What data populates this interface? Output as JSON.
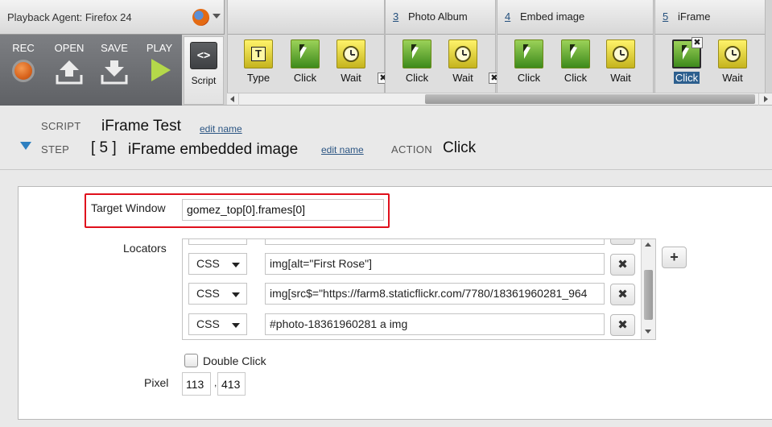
{
  "agent": {
    "title": "Playback Agent: Firefox 24",
    "browser_icon": "firefox-icon"
  },
  "controls": {
    "rec": "REC",
    "open": "OPEN",
    "save": "SAVE",
    "play": "PLAY",
    "script_icon": "<>",
    "script": "Script"
  },
  "groups": [
    {
      "number": "",
      "name": "",
      "actions": [
        {
          "label": "Type",
          "kind": "type"
        },
        {
          "label": "Click",
          "kind": "click"
        },
        {
          "label": "Wait",
          "kind": "wait"
        }
      ]
    },
    {
      "number": "3",
      "name": "Photo Album",
      "actions": [
        {
          "label": "Click",
          "kind": "click"
        },
        {
          "label": "Wait",
          "kind": "wait"
        }
      ]
    },
    {
      "number": "4",
      "name": "Embed image",
      "actions": [
        {
          "label": "Click",
          "kind": "click"
        },
        {
          "label": "Click",
          "kind": "click"
        },
        {
          "label": "Wait",
          "kind": "wait"
        }
      ]
    },
    {
      "number": "5",
      "name": "iFrame",
      "actions": [
        {
          "label": "Click",
          "kind": "click",
          "selected": true
        },
        {
          "label": "Wait",
          "kind": "wait"
        }
      ]
    }
  ],
  "info": {
    "script_caption": "SCRIPT",
    "script_name": "iFrame Test",
    "edit_name": "edit name",
    "step_caption": "STEP",
    "step_number": "[ 5 ]",
    "step_name": "iFrame embedded image",
    "action_caption": "ACTION",
    "action_value": "Click"
  },
  "form": {
    "target_window_label": "Target Window",
    "target_window_value": "gomez_top[0].frames[0]",
    "locators_label": "Locators",
    "locators": [
      {
        "type": "CSS",
        "value": "img[alt=\"First Rose\"]"
      },
      {
        "type": "CSS",
        "value": "img[src$=\"https://farm8.staticflickr.com/7780/18361960281_964"
      },
      {
        "type": "CSS",
        "value": "#photo-18361960281 a img"
      }
    ],
    "remove_glyph": "✖",
    "add_glyph": "+",
    "double_click_label": "Double Click",
    "double_click_checked": false,
    "pixel_label": "Pixel",
    "pixel_x": "113",
    "pixel_sep": ",",
    "pixel_y": "413"
  },
  "colors": {
    "highlight": "#e0101c",
    "link": "#2b5583",
    "selected": "#2d5f8e",
    "accent_green": "#3d8a1c",
    "accent_yellow": "#c5b41d"
  }
}
